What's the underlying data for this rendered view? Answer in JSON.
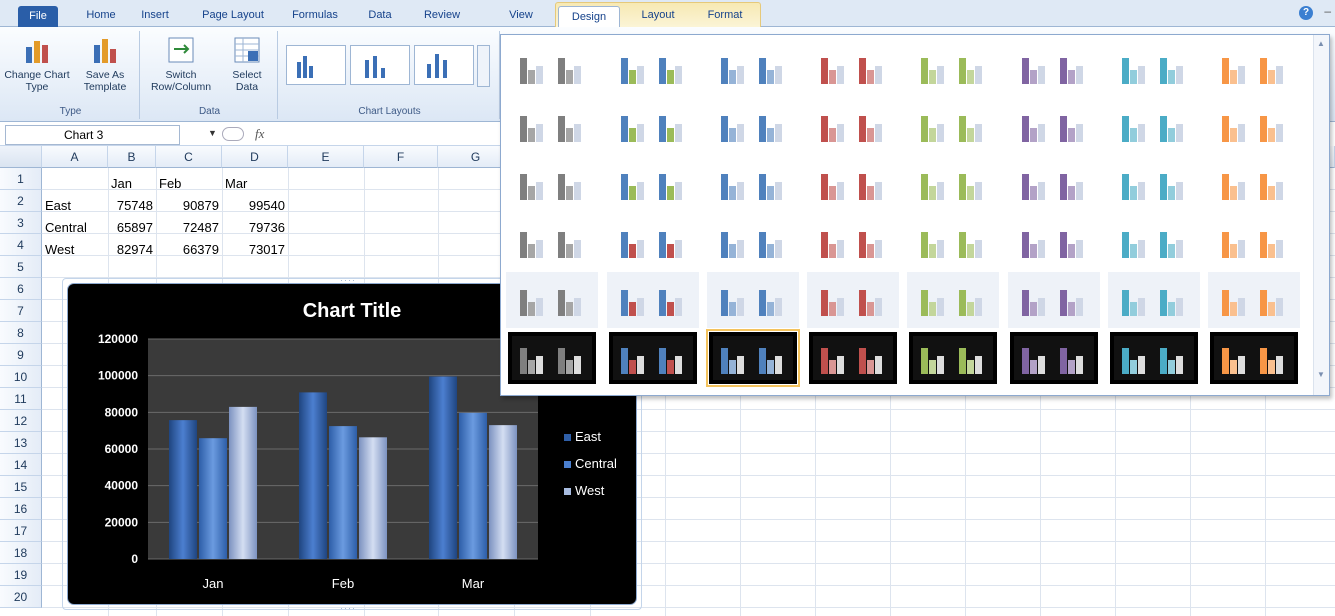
{
  "tabs": [
    "File",
    "Home",
    "Insert",
    "Page Layout",
    "Formulas",
    "Data",
    "Review",
    "View",
    "Design",
    "Layout",
    "Format"
  ],
  "active_tab": "Design",
  "ribbon": {
    "change_chart_type": "Change Chart Type",
    "save_template": "Save As Template",
    "switch_row_col": "Switch Row/Column",
    "select_data": "Select Data",
    "group_type": "Type",
    "group_data": "Data",
    "group_layouts": "Chart Layouts"
  },
  "formula_bar": {
    "name_box": "Chart 3",
    "fx": "fx"
  },
  "sheet": {
    "columns": [
      "A",
      "B",
      "C",
      "D",
      "E",
      "F",
      "G"
    ],
    "rows": [
      "1",
      "2",
      "3",
      "4",
      "5",
      "6",
      "7",
      "8",
      "9",
      "10",
      "11",
      "12",
      "13",
      "14",
      "15",
      "16",
      "17",
      "18",
      "19",
      "20"
    ],
    "header_row": [
      "",
      "Jan",
      "Feb",
      "Mar"
    ],
    "data_rows": [
      {
        "label": "East",
        "values": [
          "75748",
          "90879",
          "99540"
        ]
      },
      {
        "label": "Central",
        "values": [
          "65897",
          "72487",
          "79736"
        ]
      },
      {
        "label": "West",
        "values": [
          "82974",
          "66379",
          "73017"
        ]
      }
    ]
  },
  "chart_data": {
    "type": "bar",
    "title": "Chart Title",
    "categories": [
      "Jan",
      "Feb",
      "Mar"
    ],
    "series": [
      {
        "name": "East",
        "values": [
          75748,
          90879,
          99540
        ],
        "color": "#2f5fa8"
      },
      {
        "name": "Central",
        "values": [
          65897,
          72487,
          79736
        ],
        "color": "#4a7fcf"
      },
      {
        "name": "West",
        "values": [
          82974,
          66379,
          73017
        ],
        "color": "#a8bce0"
      }
    ],
    "ylim": [
      0,
      120000
    ],
    "yticks": [
      "0",
      "20000",
      "40000",
      "60000",
      "80000",
      "100000",
      "120000"
    ],
    "legend_position": "right",
    "grid": true
  },
  "gallery": {
    "themes": [
      "#7f7f7f",
      "#4f81bd",
      "#4f81bd",
      "#c0504d",
      "#9bbb59",
      "#8064a2",
      "#4bacc6",
      "#f79646"
    ],
    "accents": [
      "#a6a6a6",
      "#c0504d",
      "#95b3d7",
      "#d99694",
      "#c3d69b",
      "#b3a2c7",
      "#92cddc",
      "#fac08f"
    ],
    "selected": "row6-col3"
  },
  "colors": {
    "accent": "#f4c35d",
    "ribbon_bg": "#dce7f5",
    "file_tab": "#2a5ea8"
  }
}
